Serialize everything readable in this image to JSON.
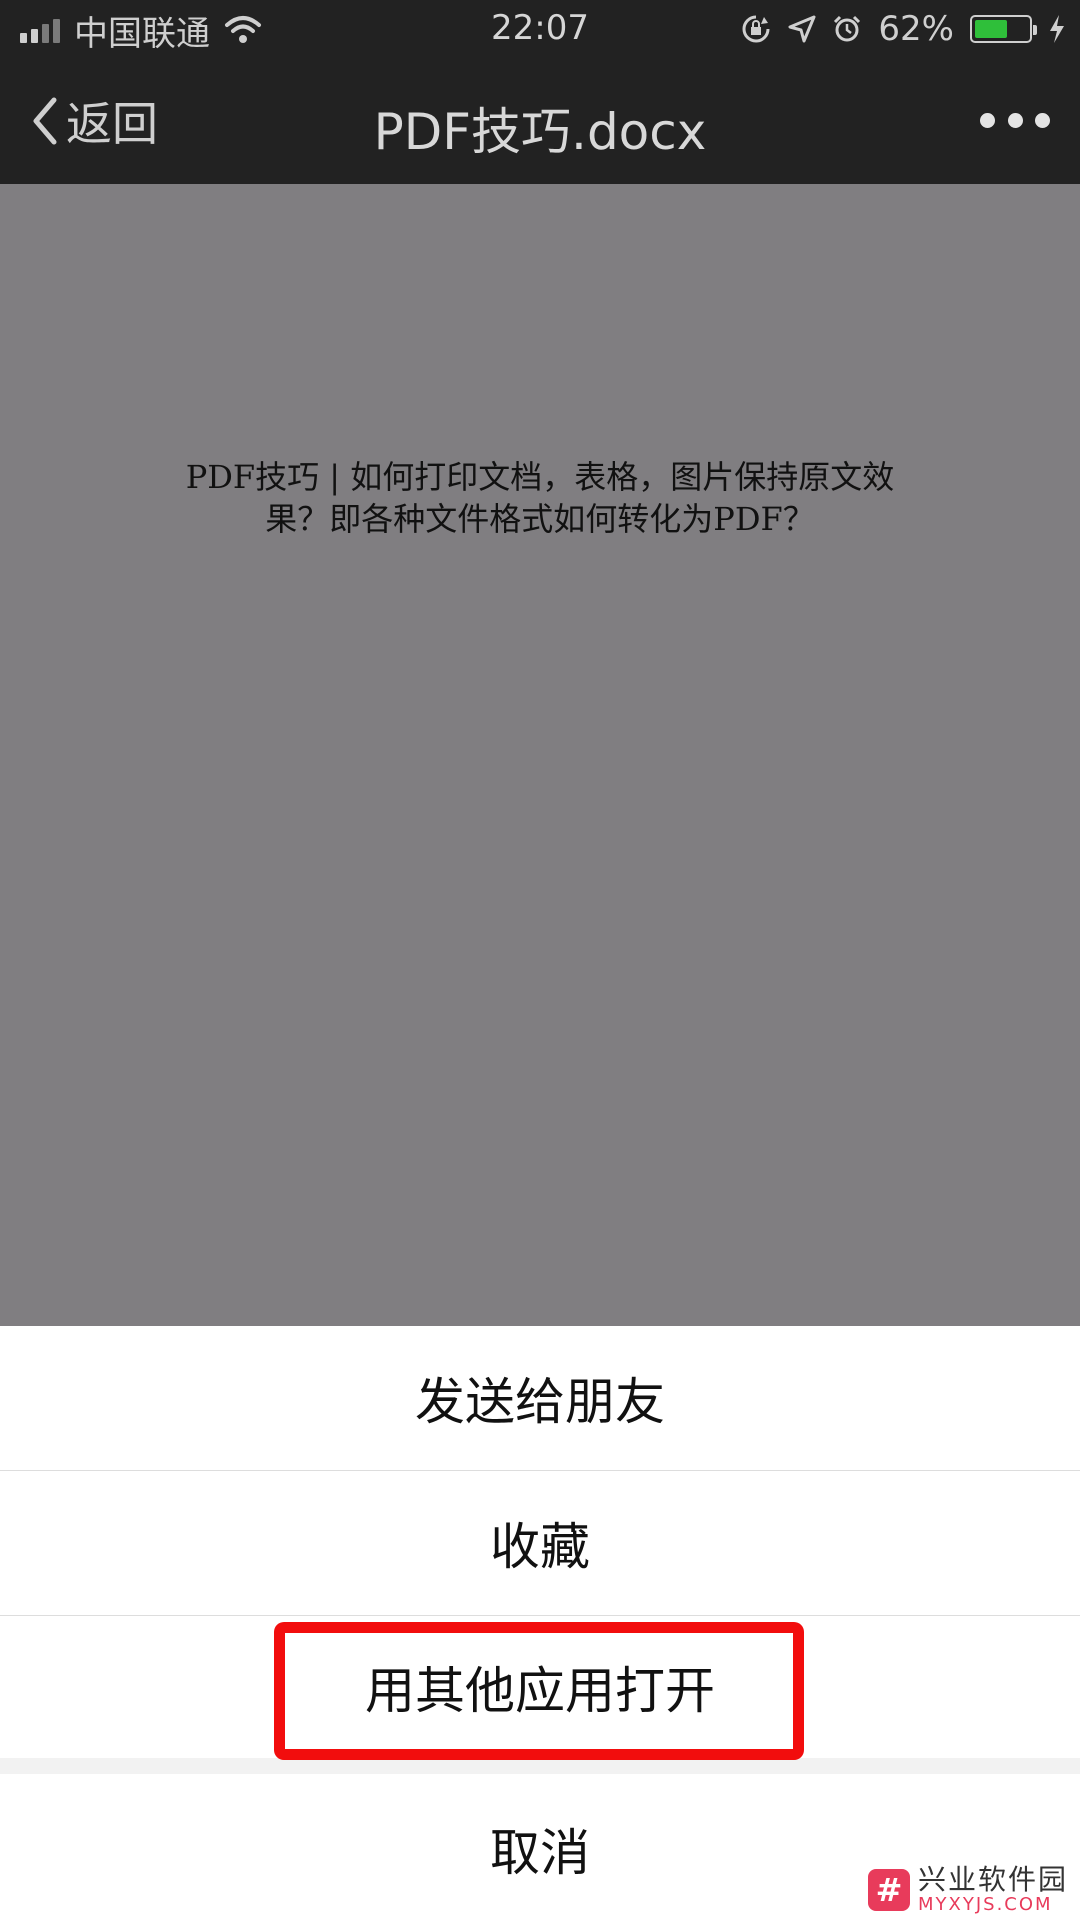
{
  "status_bar": {
    "carrier": "中国联通",
    "time": "22:07",
    "battery_percent": "62%",
    "battery_level": 0.62,
    "icons": [
      "signal-icon",
      "wifi-icon",
      "rotation-lock-icon",
      "location-arrow-icon",
      "alarm-icon",
      "battery-icon",
      "charging-bolt-icon"
    ]
  },
  "nav_bar": {
    "back_label": "返回",
    "title": "PDF技巧.docx",
    "more_icon": "more-dots-icon"
  },
  "document": {
    "line1": "PDF技巧 | 如何打印文档，表格，图片保持原文效",
    "line2": "果？即各种文件格式如何转化为PDF？"
  },
  "action_sheet": {
    "items": [
      {
        "label": "发送给朋友"
      },
      {
        "label": "收藏"
      },
      {
        "label": "用其他应用打开"
      }
    ],
    "cancel_label": "取消"
  },
  "annotation": {
    "highlight_color": "#f20d0d"
  },
  "watermark": {
    "name_cn": "兴业软件园",
    "name_en": "MYXYJS.COM"
  }
}
